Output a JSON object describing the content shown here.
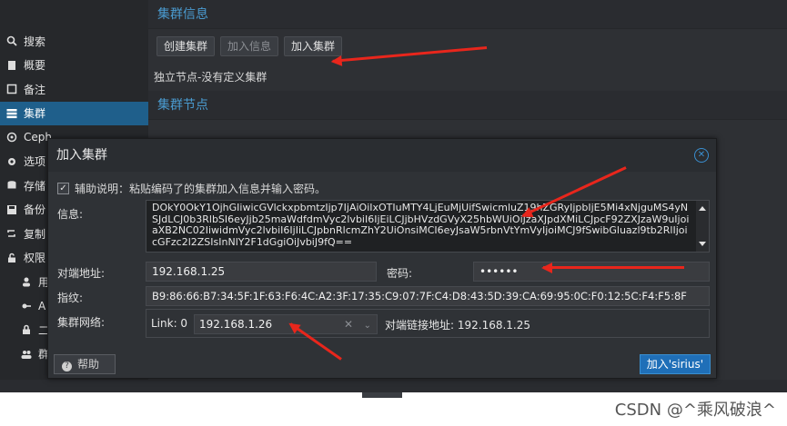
{
  "sidebar": {
    "items": [
      {
        "label": "搜索",
        "icon": "search-icon"
      },
      {
        "label": "概要",
        "icon": "book-icon"
      },
      {
        "label": "备注",
        "icon": "note-icon"
      },
      {
        "label": "集群",
        "icon": "server-icon"
      },
      {
        "label": "Ceph",
        "icon": "ceph-icon"
      },
      {
        "label": "选项",
        "icon": "gear-icon"
      },
      {
        "label": "存储",
        "icon": "database-icon"
      },
      {
        "label": "备份",
        "icon": "floppy-icon"
      },
      {
        "label": "复制",
        "icon": "retweet-icon"
      },
      {
        "label": "权限",
        "icon": "unlock-icon"
      },
      {
        "label": "用",
        "icon": "user-icon"
      },
      {
        "label": "A",
        "icon": "key-icon"
      },
      {
        "label": "二",
        "icon": "lock-icon"
      },
      {
        "label": "群",
        "icon": "users-icon"
      }
    ]
  },
  "main": {
    "header1": "集群信息",
    "buttons": {
      "create": "创建集群",
      "join_info": "加入信息",
      "join": "加入集群"
    },
    "standalone": "独立节点-没有定义集群",
    "header2": "集群节点"
  },
  "dialog": {
    "title": "加入集群",
    "help_text": "辅助说明：粘贴编码了的集群加入信息并输入密码。",
    "info_label": "信息:",
    "info_value": "DOkY0OkY1OjhGIiwicGVlckxpbmtzIjp7IjAiOiIxOTIuMTY4LjEuMjUifSwicmluZ19hZGRyIjpbIjE5Mi4xNjguMS4yNSJdLCJ0b3RlbSI6eyJjb25maWdfdmVyc2lvbiI6IjEiLCJjbHVzdGVyX25hbWUiOiJzaXJpdXMiLCJpcF92ZXJzaW9uIjoiaXB2NC02IiwidmVyc2lvbiI6IjIiLCJpbnRlcmZhY2UiOnsiMCI6eyJsaW5rbnVtYmVyIjoiMCJ9fSwibGluazl9tb2RlIjoicGFzc2l2ZSIsInNlY2F1dGgiOiJvbiJ9fQ==",
    "peer_label": "对端地址:",
    "peer_value": "192.168.1.25",
    "password_label": "密码:",
    "password_value": "••••••",
    "fingerprint_label": "指纹:",
    "fingerprint_value": "B9:86:66:B7:34:5F:1F:63:F6:4C:A2:3F:17:35:C9:07:7F:C4:D8:43:5D:39:CA:69:95:0C:F0:12:5C:F4:F5:8F",
    "network_label": "集群网络:",
    "link_label": "Link:  0",
    "link_value": "192.168.1.26",
    "peer_link": "对端链接地址: 192.168.1.25",
    "help_button": "帮助",
    "join_button": "加入'sirius'"
  },
  "watermark": "CSDN @^乘风破浪^",
  "colors": {
    "accent": "#1f6fb8",
    "header": "#4a9bd0",
    "arrow": "#e8261c"
  }
}
